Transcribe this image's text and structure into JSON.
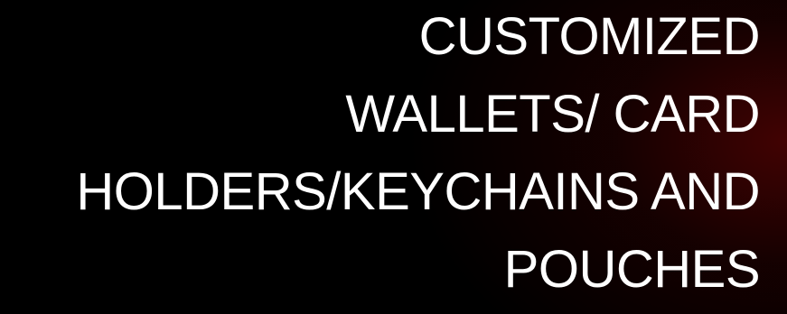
{
  "slide": {
    "title_lines": [
      "CUSTOMIZED",
      "WALLETS/ CARD",
      "HOLDERS/KEYCHAINS AND",
      "POUCHES"
    ]
  },
  "colors": {
    "background": "#000000",
    "accent_glow": "#780404",
    "text": "#ffffff"
  }
}
